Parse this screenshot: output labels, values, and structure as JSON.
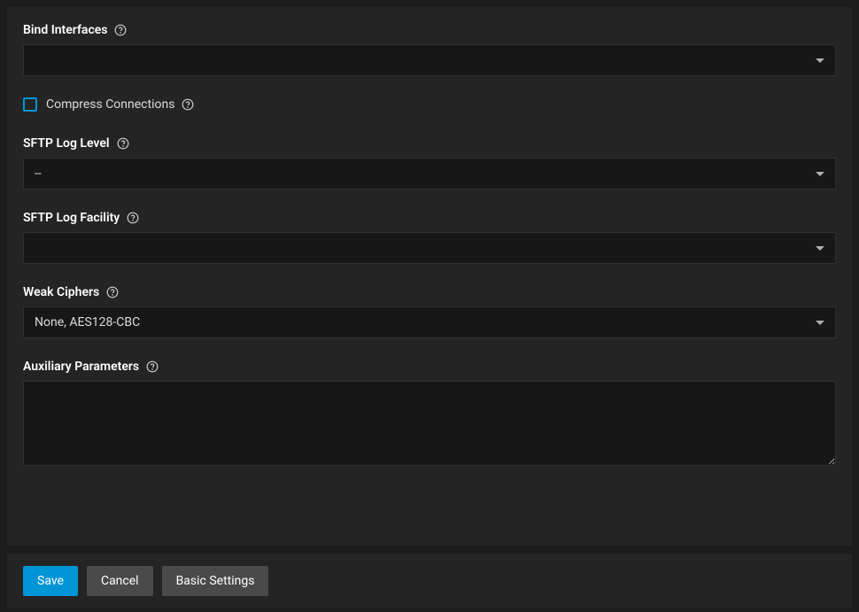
{
  "fields": {
    "bind_interfaces": {
      "label": "Bind Interfaces",
      "value": ""
    },
    "compress_connections": {
      "label": "Compress Connections",
      "checked": false
    },
    "sftp_log_level": {
      "label": "SFTP Log Level",
      "value": "--"
    },
    "sftp_log_facility": {
      "label": "SFTP Log Facility",
      "value": ""
    },
    "weak_ciphers": {
      "label": "Weak Ciphers",
      "value": "None, AES128-CBC"
    },
    "auxiliary_parameters": {
      "label": "Auxiliary Parameters",
      "value": ""
    }
  },
  "buttons": {
    "save": "Save",
    "cancel": "Cancel",
    "basic_settings": "Basic Settings"
  }
}
